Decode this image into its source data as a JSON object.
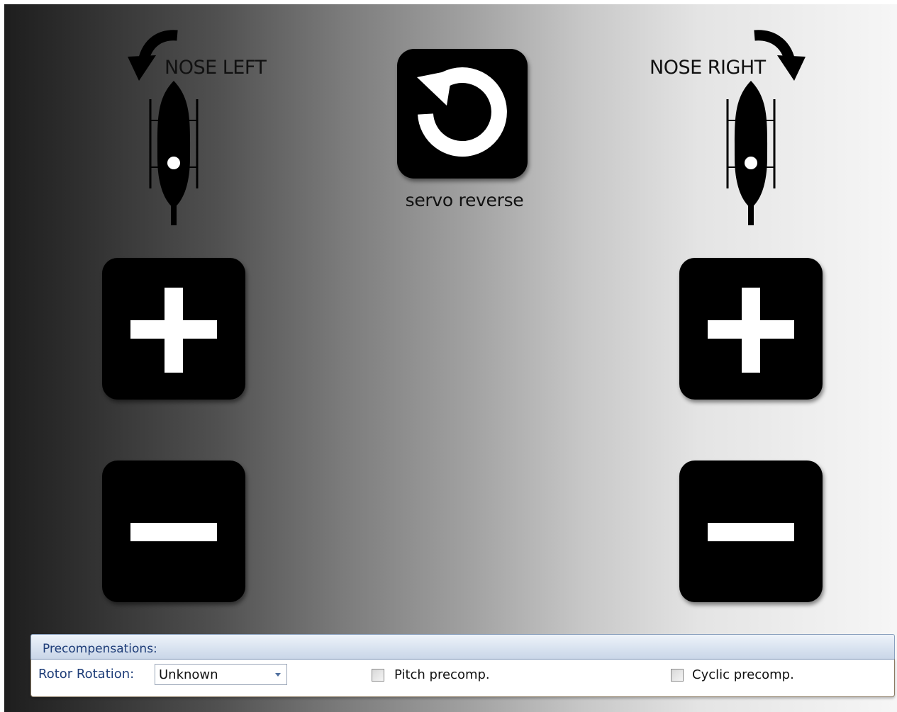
{
  "tail": {
    "nose_left_label": "NOSE LEFT",
    "nose_right_label": "NOSE RIGHT",
    "servo_reverse_label": "servo reverse",
    "left_plus_icon": "plus-icon",
    "left_minus_icon": "minus-icon",
    "right_plus_icon": "plus-icon",
    "right_minus_icon": "minus-icon",
    "servo_reverse_icon": "rotate-ccw-icon"
  },
  "precompensations": {
    "title": "Precompensations:",
    "rotor_rotation_label": "Rotor Rotation:",
    "rotor_rotation_value": "Unknown",
    "pitch_precomp_label": "Pitch precomp.",
    "pitch_precomp_checked": false,
    "cyclic_precomp_label": "Cyclic precomp.",
    "cyclic_precomp_checked": false
  },
  "colors": {
    "button_bg": "#000000",
    "header_text": "#1e3d78"
  }
}
